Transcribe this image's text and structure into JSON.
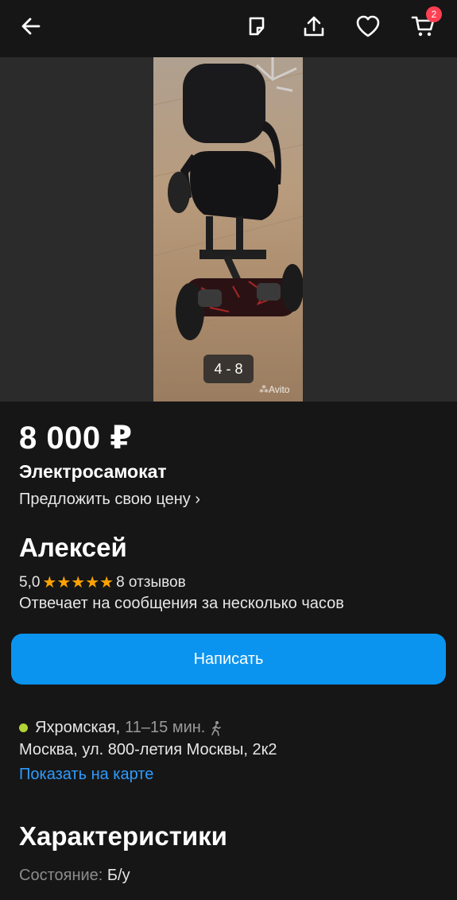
{
  "header": {
    "cart_count": "2",
    "icons": [
      "back-arrow-icon",
      "note-icon",
      "share-icon",
      "heart-icon",
      "cart-icon"
    ]
  },
  "gallery": {
    "counter": "4 - 8",
    "watermark": "Avito"
  },
  "listing": {
    "price": "8 000 ₽",
    "title": "Электросамокат",
    "offer_price": "Предложить свою цену ›"
  },
  "seller": {
    "name": "Алексей",
    "rating": "5,0",
    "stars": "★★★★★",
    "reviews": "8 отзывов",
    "reply_time": "Отвечает на сообщения за несколько часов"
  },
  "actions": {
    "write_label": "Написать"
  },
  "location": {
    "metro": "Яхромская,",
    "metro_time": "11–15 мин.",
    "metro_color": "#b4d334",
    "address": "Москва, ул. 800-летия Москвы, 2к2",
    "map_link": "Показать на карте"
  },
  "specs": {
    "heading": "Характеристики",
    "items": [
      {
        "key": "Состояние:",
        "value": "Б/у"
      }
    ]
  },
  "colors": {
    "background": "#161616",
    "accent_button": "#0a94f0",
    "link": "#2e9bff",
    "star": "#ffa200",
    "badge": "#ff4053"
  }
}
